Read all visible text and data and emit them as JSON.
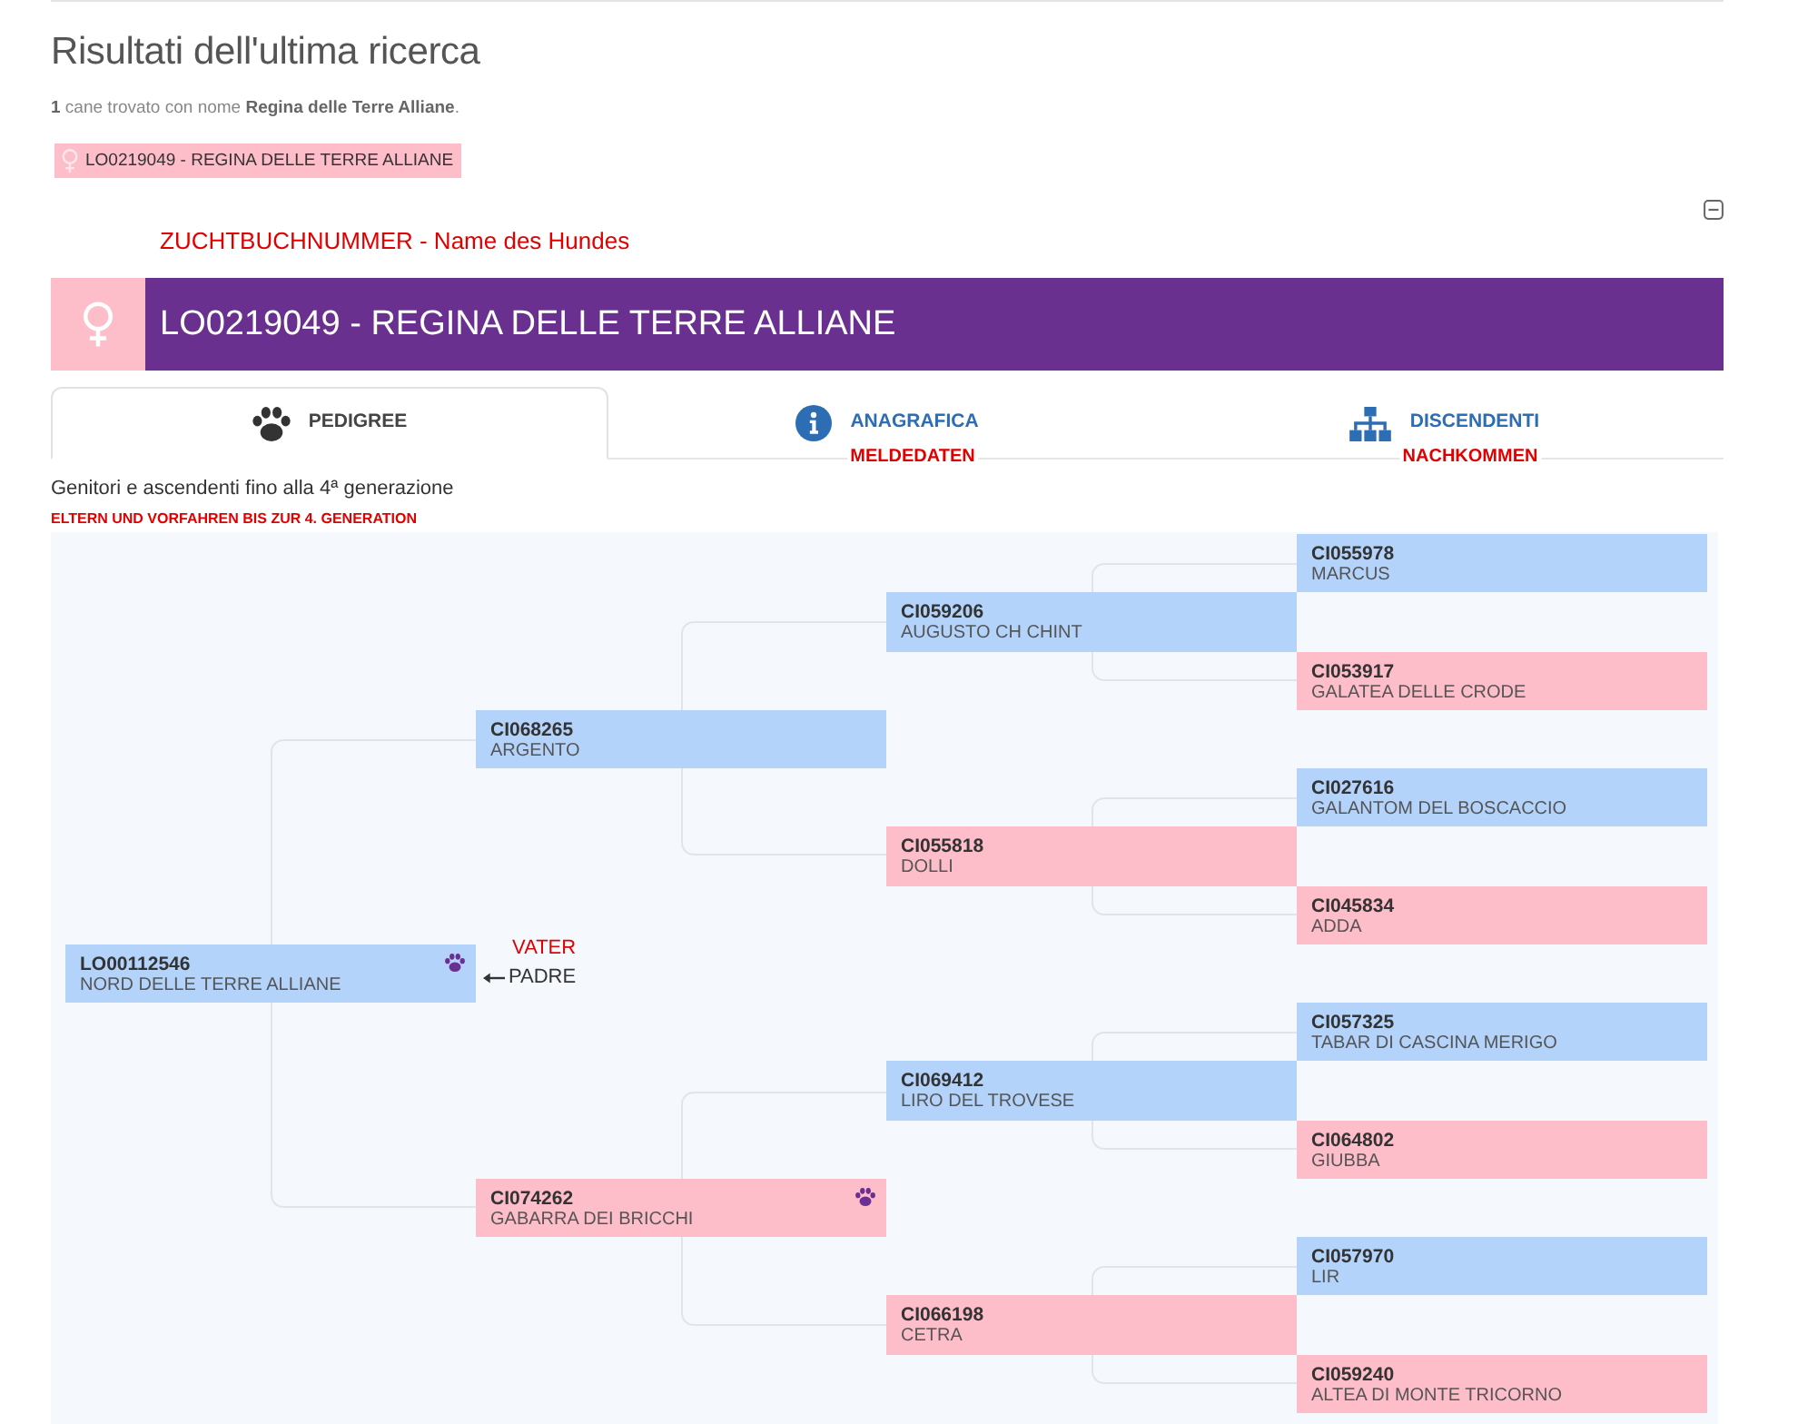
{
  "page": {
    "title": "Risultati dell'ultima ricerca",
    "summary": "**1** cane trovato con nome **Regina delle Terre Alliane**."
  },
  "result_chip": {
    "female": true,
    "label": "LO0219049 - REGINA DELLE TERRE ALLIANE"
  },
  "annotation": "ZUCHTBUCHNUMMER - Name des Hundes",
  "panel": {
    "expanded": true
  },
  "dog_header": {
    "female": true,
    "title": "LO0219049 - REGINA DELLE TERRE ALLIANE"
  },
  "tabs": [
    {
      "kind": "pedigree",
      "label": "PEDIGREE",
      "selected": true
    },
    {
      "kind": "details",
      "label": "ANAGRAFICA",
      "selected": false,
      "annotation": "MELDEDATEN"
    },
    {
      "kind": "offspring",
      "label": "DISCENDENTI",
      "selected": false,
      "annotation": "NACHKOMMEN"
    }
  ],
  "pedigree": {
    "intro": "Genitori e ascendenti fino alla 4ª generazione",
    "annotation": "ELTERN UND VORFAHREN BIS ZUR 4. GENERATION",
    "tree": [
      {
        "reg_no": "LO00112546",
        "name": "NORD DELLE TERRE ALLIANE",
        "female": false,
        "paw_icon": true,
        "label": "PADRE",
        "label_annotation": "VATER",
        "parents": [
          {
            "reg_no": "CI068265",
            "name": "ARGENTO",
            "female": false,
            "paw_icon": false,
            "parents": [
              {
                "reg_no": "CI059206",
                "name": "AUGUSTO CH CHINT",
                "female": false,
                "paw_icon": false,
                "parents": [
                  {
                    "reg_no": "CI055978",
                    "name": "MARCUS",
                    "female": false,
                    "paw_icon": false
                  },
                  {
                    "reg_no": "CI053917",
                    "name": "GALATEA DELLE CRODE",
                    "female": true,
                    "paw_icon": false
                  }
                ]
              },
              {
                "reg_no": "CI055818",
                "name": "DOLLI",
                "female": true,
                "paw_icon": false,
                "parents": [
                  {
                    "reg_no": "CI027616",
                    "name": "GALANTOM DEL BOSCACCIO",
                    "female": false,
                    "paw_icon": false
                  },
                  {
                    "reg_no": "CI045834",
                    "name": "ADDA",
                    "female": true,
                    "paw_icon": false
                  }
                ]
              }
            ]
          },
          {
            "reg_no": "CI074262",
            "name": "GABARRA DEI BRICCHI",
            "female": true,
            "paw_icon": true,
            "parents": [
              {
                "reg_no": "CI069412",
                "name": "LIRO DEL TROVESE",
                "female": false,
                "paw_icon": false,
                "parents": [
                  {
                    "reg_no": "CI057325",
                    "name": "TABAR DI CASCINA MERIGO",
                    "female": false,
                    "paw_icon": false
                  },
                  {
                    "reg_no": "CI064802",
                    "name": "GIUBBA",
                    "female": true,
                    "paw_icon": false
                  }
                ]
              },
              {
                "reg_no": "CI066198",
                "name": "CETRA",
                "female": true,
                "paw_icon": false,
                "parents": [
                  {
                    "reg_no": "CI057970",
                    "name": "LIR",
                    "female": false,
                    "paw_icon": false
                  },
                  {
                    "reg_no": "CI059240",
                    "name": "ALTEA DI MONTE TRICORNO",
                    "female": true,
                    "paw_icon": false
                  }
                ]
              }
            ]
          }
        ]
      }
    ]
  }
}
